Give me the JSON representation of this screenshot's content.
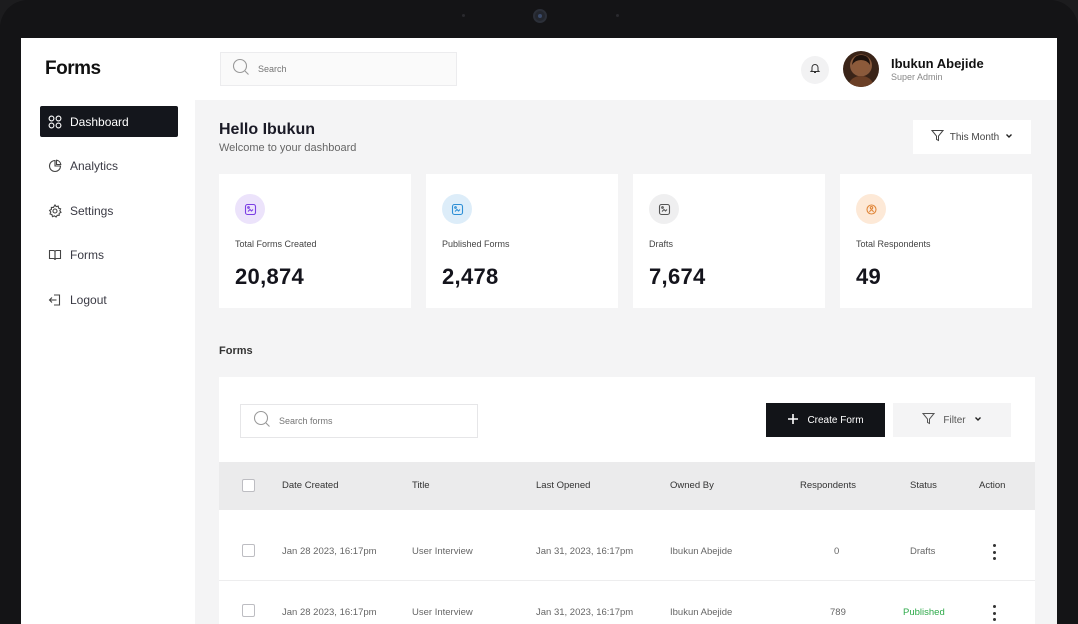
{
  "app": {
    "logo": "Forms"
  },
  "sidebar": {
    "items": [
      {
        "label": "Dashboard",
        "icon": "dashboard-icon",
        "active": true
      },
      {
        "label": "Analytics",
        "icon": "pie-chart-icon"
      },
      {
        "label": "Settings",
        "icon": "gear-icon"
      },
      {
        "label": "Forms",
        "icon": "book-icon"
      },
      {
        "label": "Logout",
        "icon": "logout-icon"
      }
    ]
  },
  "topbar": {
    "search_placeholder": "Search",
    "user": {
      "name": "Ibukun Abejide",
      "role": "Super Admin"
    }
  },
  "header": {
    "greeting": "Hello Ibukun",
    "subtitle": "Welcome to your dashboard",
    "period": "This Month"
  },
  "stats": [
    {
      "label": "Total Forms Created",
      "value": "20,874",
      "icon": "document-icon",
      "color": "#7b3fe4"
    },
    {
      "label": "Published Forms",
      "value": "2,478",
      "icon": "document-icon",
      "color": "#2d8fd6"
    },
    {
      "label": "Drafts",
      "value": "7,674",
      "icon": "document-icon",
      "color": "#555555"
    },
    {
      "label": "Total Respondents",
      "value": "49",
      "icon": "respondents-icon",
      "color": "#e0873a"
    }
  ],
  "forms": {
    "title": "Forms",
    "search_placeholder": "Search forms",
    "create_label": "Create Form",
    "filter_label": "Filter",
    "columns": [
      "Date Created",
      "Title",
      "Last Opened",
      "Owned By",
      "Respondents",
      "Status",
      "Action"
    ],
    "rows": [
      {
        "date": "Jan 28 2023, 16:17pm",
        "title": "User Interview",
        "last_opened": "Jan 31, 2023, 16:17pm",
        "owner": "Ibukun Abejide",
        "respondents": "0",
        "status": "Drafts"
      },
      {
        "date": "Jan 28 2023, 16:17pm",
        "title": "User Interview",
        "last_opened": "Jan 31, 2023, 16:17pm",
        "owner": "Ibukun Abejide",
        "respondents": "789",
        "status": "Published"
      }
    ]
  },
  "colors": {
    "accent": "#121418",
    "published": "#2eaa4a"
  }
}
